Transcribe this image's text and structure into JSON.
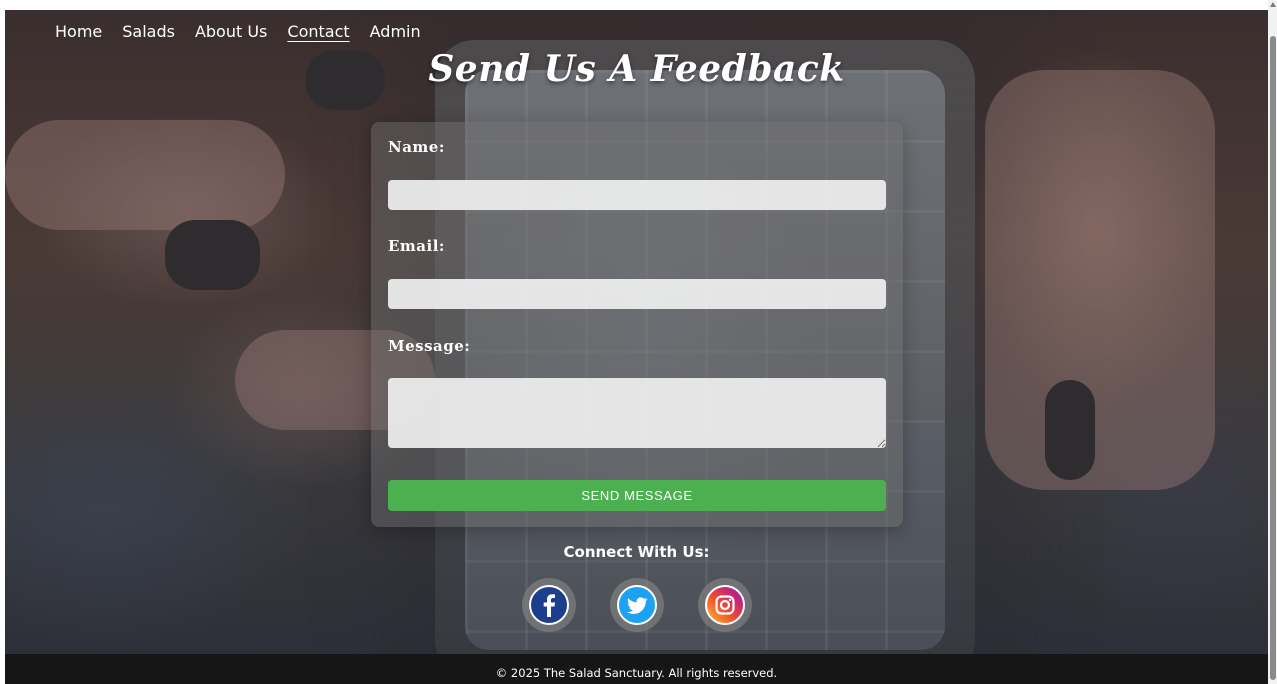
{
  "nav": {
    "items": [
      {
        "label": "Home",
        "active": false
      },
      {
        "label": "Salads",
        "active": false
      },
      {
        "label": "About Us",
        "active": false
      },
      {
        "label": "Contact",
        "active": true
      },
      {
        "label": "Admin",
        "active": false
      }
    ]
  },
  "page": {
    "title": "Send Us A Feedback"
  },
  "form": {
    "name_label": "Name:",
    "name_value": "",
    "email_label": "Email:",
    "email_value": "",
    "message_label": "Message:",
    "message_value": "",
    "submit_label": "SEND MESSAGE",
    "submit_color": "#4caf50"
  },
  "social": {
    "title": "Connect With Us:",
    "links": [
      {
        "icon": "facebook-icon"
      },
      {
        "icon": "twitter-icon"
      },
      {
        "icon": "instagram-icon"
      }
    ]
  },
  "footer": {
    "text": "© 2025 The Salad Sanctuary. All rights reserved."
  }
}
